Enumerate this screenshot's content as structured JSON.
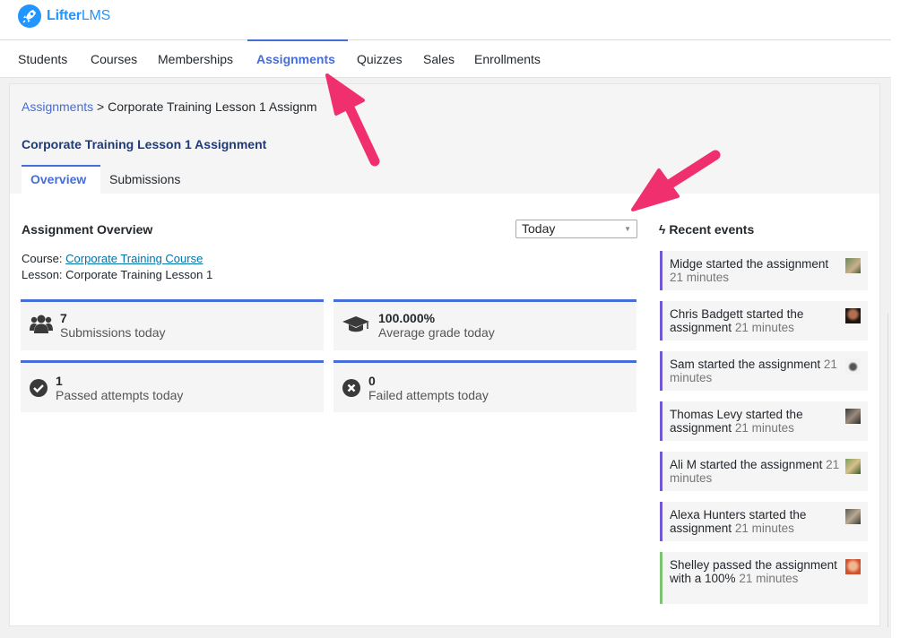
{
  "brand": {
    "name_bold": "Lifter",
    "name_light": "LMS",
    "accent": "#2295ff"
  },
  "nav": {
    "items": [
      "Students",
      "Courses",
      "Memberships",
      "Assignments",
      "Quizzes",
      "Sales",
      "Enrollments"
    ],
    "active": "Assignments"
  },
  "breadcrumb": {
    "root": "Assignments",
    "separator": " > ",
    "current": "Corporate Training Lesson 1 Assignm"
  },
  "page_title": "Corporate Training Lesson 1 Assignment",
  "tabs": [
    "Overview",
    "Submissions"
  ],
  "overview": {
    "title": "Assignment Overview",
    "period_select": "Today",
    "course_label": "Course: ",
    "course_link": "Corporate Training Course",
    "lesson_text": "Lesson: Corporate Training Lesson 1"
  },
  "stats": [
    {
      "icon": "users-icon",
      "value": "7",
      "label": "Submissions today"
    },
    {
      "icon": "graduation-cap-icon",
      "value": "100.000%",
      "label": "Average grade today"
    },
    {
      "icon": "check-circle-icon",
      "value": "1",
      "label": "Passed attempts today"
    },
    {
      "icon": "times-circle-icon",
      "value": "0",
      "label": "Failed attempts today"
    }
  ],
  "events": {
    "title": "Recent events",
    "items": [
      {
        "text": "Midge started the assignment",
        "time": "21 minutes",
        "type": "start"
      },
      {
        "text": "Chris Badgett started the assignment",
        "time": "21 minutes",
        "type": "start"
      },
      {
        "text": "Sam started the assignment",
        "time": "21 minutes",
        "type": "start"
      },
      {
        "text": "Thomas Levy started the assignment",
        "time": "21 minutes",
        "type": "start"
      },
      {
        "text": "Ali M started the assignment",
        "time": "21 minutes",
        "type": "start"
      },
      {
        "text": "Alexa Hunters started the assignment",
        "time": "21 minutes",
        "type": "start"
      },
      {
        "text": "Shelley passed the assignment with a 100%",
        "time": "21 minutes",
        "type": "pass"
      }
    ]
  },
  "colors": {
    "primary": "#466dd8",
    "event_start": "#7159d3",
    "event_pass": "#7cc472",
    "annotation_arrow": "#f0306e"
  }
}
